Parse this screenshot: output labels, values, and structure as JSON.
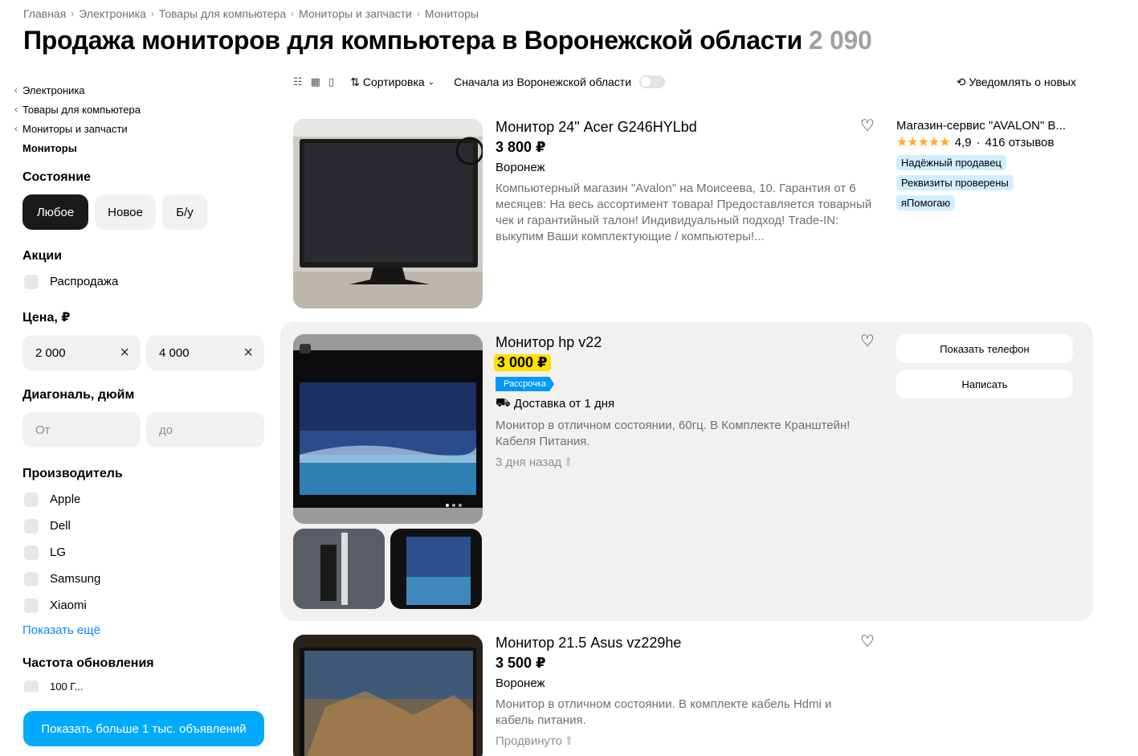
{
  "breadcrumb": [
    "Главная",
    "Электроника",
    "Товары для компьютера",
    "Мониторы и запчасти",
    "Мониторы"
  ],
  "title": {
    "text": "Продажа мониторов для компьютера в Воронежской области",
    "count": "2 090"
  },
  "sidebar": {
    "categories": [
      "Электроника",
      "Товары для компьютера",
      "Мониторы и запчасти"
    ],
    "current_category": "Мониторы",
    "condition": {
      "title": "Состояние",
      "options": [
        "Любое",
        "Новое",
        "Б/у"
      ],
      "selected": "Любое"
    },
    "promo": {
      "title": "Акции",
      "options": [
        "Распродажа"
      ]
    },
    "price": {
      "title": "Цена, ₽",
      "from": "2 000",
      "to": "4 000"
    },
    "diagonal": {
      "title": "Диагональ, дюйм",
      "from_placeholder": "От",
      "to_placeholder": "до"
    },
    "maker": {
      "title": "Производитель",
      "options": [
        "Apple",
        "Dell",
        "LG",
        "Samsung",
        "Xiaomi"
      ],
      "show_more": "Показать ещё"
    },
    "refresh": {
      "title": "Частота обновления",
      "partial": "100 Г..."
    },
    "show_more_button": "Показать больше 1 тыс. объявлений"
  },
  "toolbar": {
    "sort_label": "Сортировка",
    "region_label": "Сначала из Воронежской области",
    "notify_label": "Уведомлять о новых"
  },
  "listings": [
    {
      "title": "Монитор 24\" Acer G246HYLbd",
      "price": "3 800 ₽",
      "location": "Воронеж",
      "description": "Компьютерный магазин \"Avalon\" на Моисеева, 10. Гарантия от 6 месяцев: На весь ассортимент товара! Предоставляется товарный чек и гарантийный талон! Индивидуальный подход! Trade-IN: выкупим Ваши комплектующие / компьютеры!...",
      "seller": {
        "name": "Магазин-сервис \"AVALON\" В...",
        "rating": "4,9",
        "rating_value": 4.9,
        "reviews": "416 отзывов",
        "tags": [
          "Надёжный продавец",
          "Реквизиты проверены",
          "яПомогаю"
        ]
      }
    },
    {
      "title": "Монитор hp v22",
      "price": "3 000 ₽",
      "badge": "Рассрочка",
      "delivery": "Доставка от 1 дня",
      "description": "Монитор в отличном состоянии, 60гц. В Комплекте Кранштейн! Кабеля Питания.",
      "meta": "3 дня назад",
      "buttons": {
        "phone": "Показать телефон",
        "write": "Написать"
      }
    },
    {
      "title": "Монитор 21.5 Asus vz229he",
      "price": "3 500 ₽",
      "location": "Воронеж",
      "description": "Монитор в отличном состоянии. В комплекте кабель Hdmi и кабель питания.",
      "meta": "Продвинуто"
    }
  ],
  "colors": {
    "accent_blue": "#00aaff",
    "price_highlight": "#ffe100",
    "tag_bg": "#cfeeff"
  }
}
